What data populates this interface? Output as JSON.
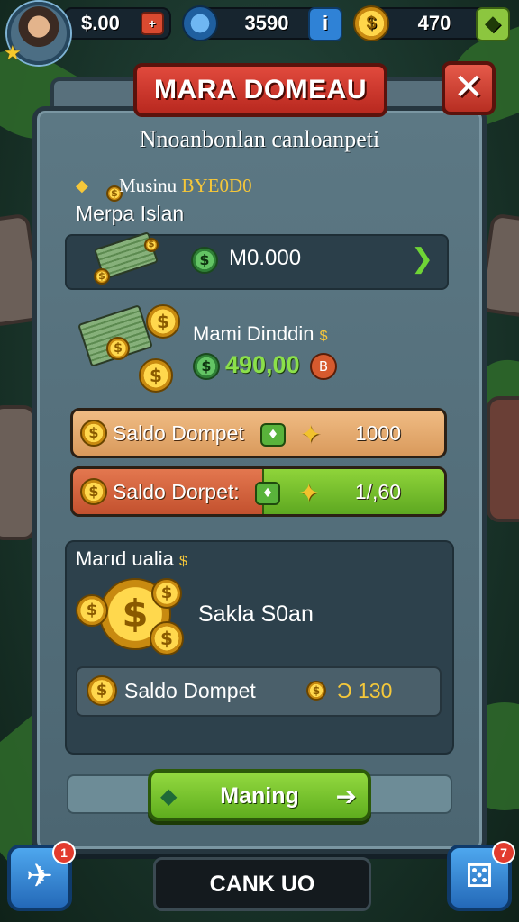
{
  "hud": {
    "cash": "$.00",
    "gems": "3590",
    "coins": "470",
    "cash_plus_icon": "plus-icon",
    "gem_icon": "gem-icon",
    "info_icon": "info-icon",
    "coin_icon": "coin-icon",
    "add_icon": "add-icon"
  },
  "dialog": {
    "title": "MARA DOMEAU",
    "subtitle": "Nnoanbonlan canloanpeti",
    "close_icon": "close-icon"
  },
  "section": {
    "top_label": "Musinu",
    "top_label_accent": "BYE0D0",
    "label": "Merpa Islan",
    "row_value": "M0.000",
    "reward_title": "Mami Dinddin",
    "reward_title_suffix": "$",
    "reward_value": "490,00",
    "reward_tag": "B"
  },
  "wallet_bars": [
    {
      "label": "Saldo Dompet",
      "value": "1000",
      "fill": 0
    },
    {
      "label": "Saldo Dorpet:",
      "value": "1/,60",
      "fill": 0.49
    }
  ],
  "lower": {
    "title": "Marıd ualia",
    "title_suffix": "$",
    "caption": "Sakla S0an",
    "wallet_label": "Saldo Dompet",
    "wallet_value": "Ɔ 130"
  },
  "buttons": {
    "primary": "Maning",
    "bottom": "CANK UO"
  },
  "corners": {
    "left_badge": "1",
    "right_badge": "7"
  },
  "colors": {
    "accent_red": "#d63a2e",
    "accent_green": "#7cc72f",
    "gold": "#f6c739",
    "panel": "#58707c"
  }
}
